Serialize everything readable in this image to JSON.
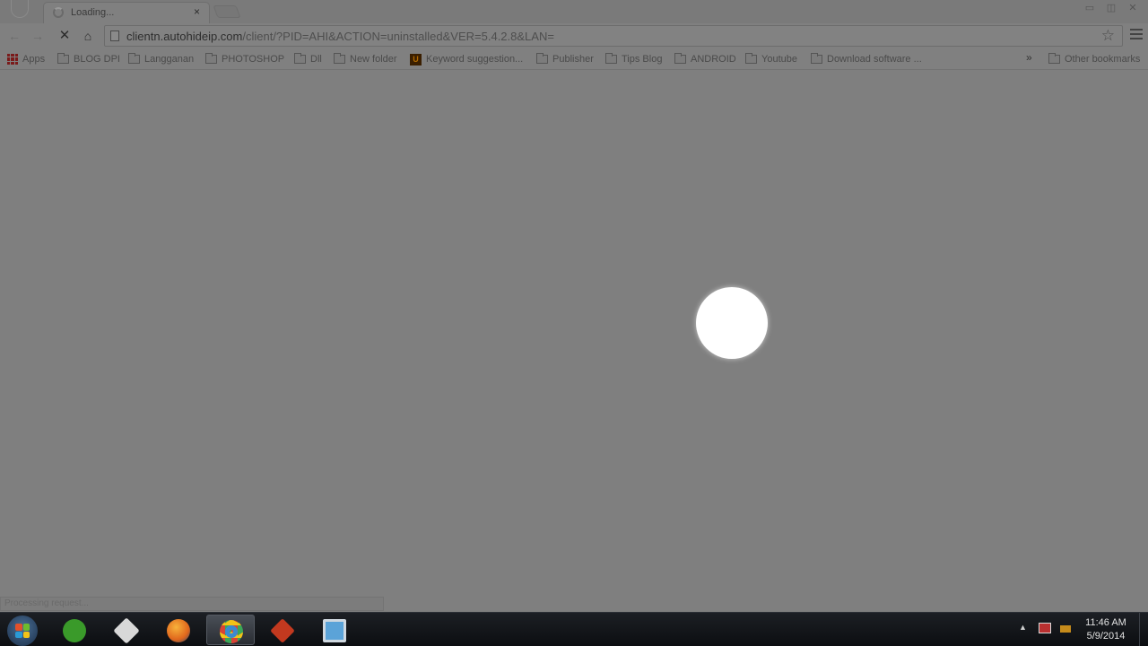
{
  "browser": {
    "tab": {
      "title": "Loading...",
      "close_glyph": "×"
    },
    "window_controls": {
      "minimize": "▭",
      "maximize": "◫",
      "close": "✕"
    },
    "toolbar": {
      "back_glyph": "←",
      "forward_glyph": "→",
      "stop_glyph": "✕",
      "home_glyph": "⌂",
      "star_glyph": "☆"
    },
    "address_bar": {
      "domain": "clientn.autohideip.com",
      "path": "/client/?PID=AHI&ACTION=uninstalled&VER=5.4.2.8&LAN="
    },
    "bookmarks": [
      {
        "label": "Apps",
        "icon": "apps-grid-icon"
      },
      {
        "label": "BLOG DPI",
        "icon": "folder-icon"
      },
      {
        "label": "Langganan",
        "icon": "folder-icon"
      },
      {
        "label": "PHOTOSHOP",
        "icon": "folder-icon"
      },
      {
        "label": "Dll",
        "icon": "folder-icon"
      },
      {
        "label": "New folder",
        "icon": "folder-icon"
      },
      {
        "label": "Keyword suggestion...",
        "icon": "keyword-tool-icon"
      },
      {
        "label": "Publisher",
        "icon": "folder-icon"
      },
      {
        "label": "Tips Blog",
        "icon": "folder-icon"
      },
      {
        "label": "ANDROID",
        "icon": "folder-icon"
      },
      {
        "label": "Youtube",
        "icon": "folder-icon"
      },
      {
        "label": "Download software ...",
        "icon": "folder-icon"
      }
    ],
    "bookmarks_overflow": "»",
    "other_bookmarks": "Other bookmarks",
    "status_text": "Processing request..."
  },
  "taskbar": {
    "apps": [
      {
        "name": "green-app-icon",
        "color": "#3a9a2a"
      },
      {
        "name": "delphi-app-icon",
        "color": "#d8d8d8"
      },
      {
        "name": "firefox-icon",
        "color": "#e0661c"
      },
      {
        "name": "chrome-icon",
        "color": "#3a8ad0"
      },
      {
        "name": "tool-app-icon",
        "color": "#c2391f"
      },
      {
        "name": "remote-desktop-icon",
        "color": "#5ba3d8"
      }
    ],
    "clock": {
      "time": "11:46 AM",
      "date": "5/9/2014"
    },
    "tray_arrow": "▲"
  },
  "colors": {
    "overlay": "#7f7f7f",
    "taskbar": "#0c0e11",
    "cursor_highlight": "#ffffff"
  }
}
